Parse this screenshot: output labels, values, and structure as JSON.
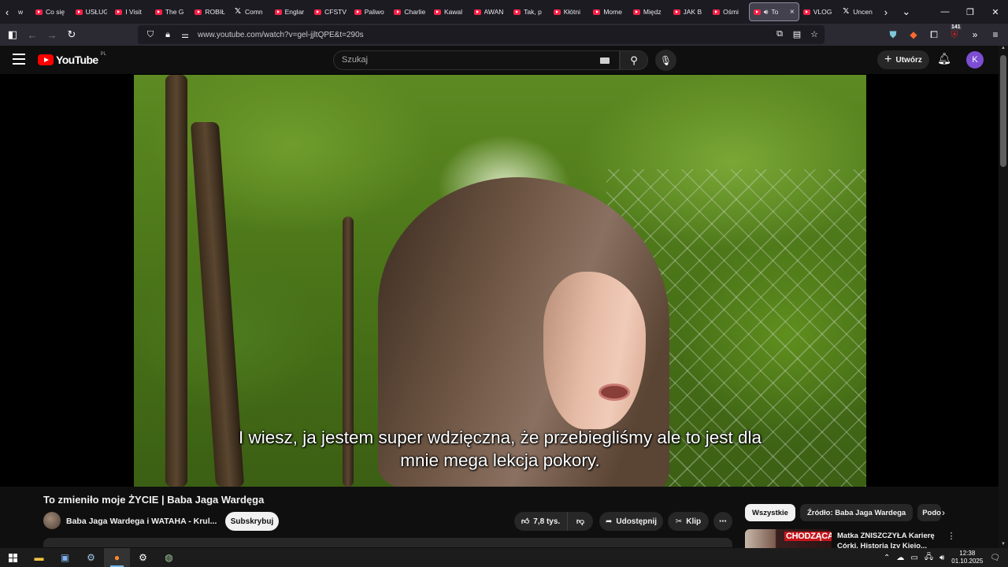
{
  "browser": {
    "tabs": [
      {
        "label": "w",
        "icon": "chevron-left-icon"
      },
      {
        "label": "Co się",
        "icon": "youtube-favicon"
      },
      {
        "label": "USŁUG",
        "icon": "youtube-favicon"
      },
      {
        "label": "I Visit",
        "icon": "youtube-favicon"
      },
      {
        "label": "The G",
        "icon": "youtube-favicon"
      },
      {
        "label": "ROBIŁ",
        "icon": "youtube-favicon"
      },
      {
        "label": "Comn",
        "icon": "x-favicon"
      },
      {
        "label": "Englar",
        "icon": "youtube-favicon"
      },
      {
        "label": "CFSTV",
        "icon": "youtube-favicon"
      },
      {
        "label": "Paliwo",
        "icon": "youtube-favicon"
      },
      {
        "label": "Charlie",
        "icon": "youtube-favicon"
      },
      {
        "label": "Kawal",
        "icon": "youtube-favicon"
      },
      {
        "label": "AWAN",
        "icon": "youtube-favicon"
      },
      {
        "label": "Tak, p",
        "icon": "youtube-favicon"
      },
      {
        "label": "Kłótni",
        "icon": "youtube-favicon"
      },
      {
        "label": "Mome",
        "icon": "youtube-favicon"
      },
      {
        "label": "Międz",
        "icon": "youtube-favicon"
      },
      {
        "label": "JAK B",
        "icon": "youtube-favicon"
      },
      {
        "label": "Ośmi",
        "icon": "youtube-favicon"
      }
    ],
    "active_tab": {
      "label": "To",
      "close": "×"
    },
    "tabs_after": [
      {
        "label": "VLOG",
        "icon": "youtube-favicon"
      },
      {
        "label": "Uncen",
        "icon": "x-favicon"
      }
    ],
    "url": "www.youtube.com/watch?v=gel-jjltQPE&t=290s",
    "extension_badge": "141"
  },
  "youtube": {
    "logo_text": "YouTube",
    "country_code": "PL",
    "search_placeholder": "Szukaj",
    "create_label": "Utwórz",
    "avatar_letter": "K"
  },
  "video": {
    "subtitle_line1": "I wiesz, ja jestem super wdzięczna, że przebiegliśmy ale to jest dla",
    "subtitle_line2": "mnie mega lekcja pokory.",
    "title": "To zmieniło moje ŻYCIE | Baba Jaga Wardęga",
    "channel": "Baba Jaga Wardega i WATAHA - Krul...",
    "subscribe_label": "Subskrybuj",
    "likes": "7,8 tys.",
    "share_label": "Udostępnij",
    "clip_label": "Klip"
  },
  "sidebar": {
    "chips": [
      "Wszystkie",
      "Źródło: Baba Jaga Wardega",
      "Podob"
    ],
    "recommendation": {
      "thumb_text": "CHODZĄCA",
      "title_line1": "Matka ZNISZCZYŁA Karierę",
      "title_line2": "Córki. Historia Izy Kiejo..."
    }
  },
  "taskbar": {
    "time": "12:38",
    "date": "01.10.2025"
  },
  "colors": {
    "youtube_red": "#ff0000",
    "page_bg": "#0f0f0f",
    "browser_chrome": "#1c1b22",
    "avatar_purple": "#7d4ed3"
  }
}
